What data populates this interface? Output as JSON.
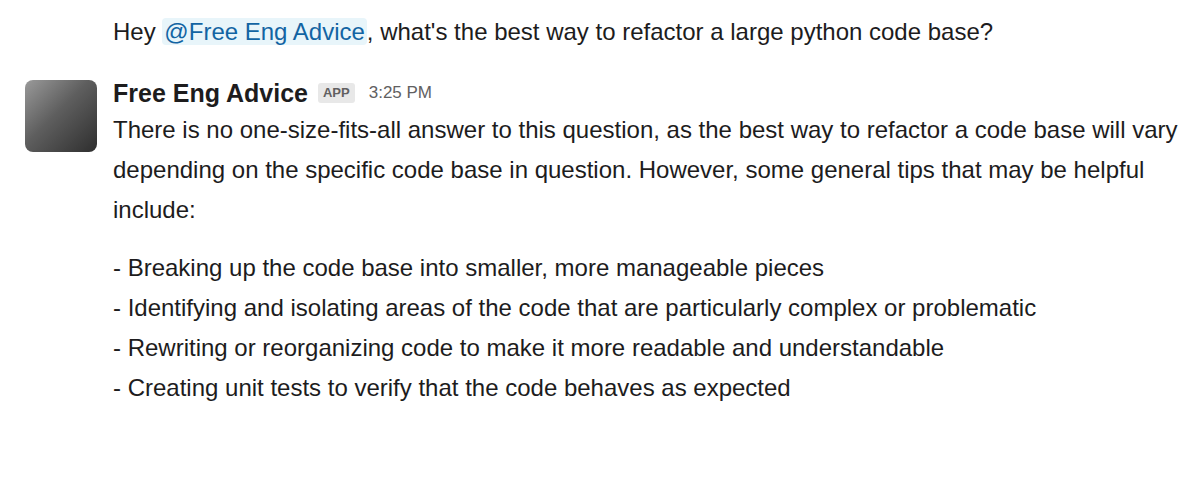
{
  "message": {
    "parts": [
      {
        "text": "Hey ",
        "kind": "text"
      },
      {
        "text": "@Free Eng Advice",
        "kind": "mention"
      },
      {
        "text": ", what's the best way to refactor a large python code base?",
        "kind": "text"
      }
    ]
  },
  "reply": {
    "author": "Free Eng Advice",
    "badge": "APP",
    "time": "3:25 PM",
    "intro": "There is no one-size-fits-all answer to this question, as the best way to refactor a code base will vary depending on the specific code base in question. However, some general tips that may be helpful include:",
    "items": [
      "- Breaking up the code base into smaller, more manageable pieces",
      "- Identifying and isolating areas of the code that are particularly complex or problematic",
      "- Rewriting or reorganizing code to make it more readable and understandable",
      "- Creating unit tests to verify that the code behaves as expected"
    ]
  }
}
